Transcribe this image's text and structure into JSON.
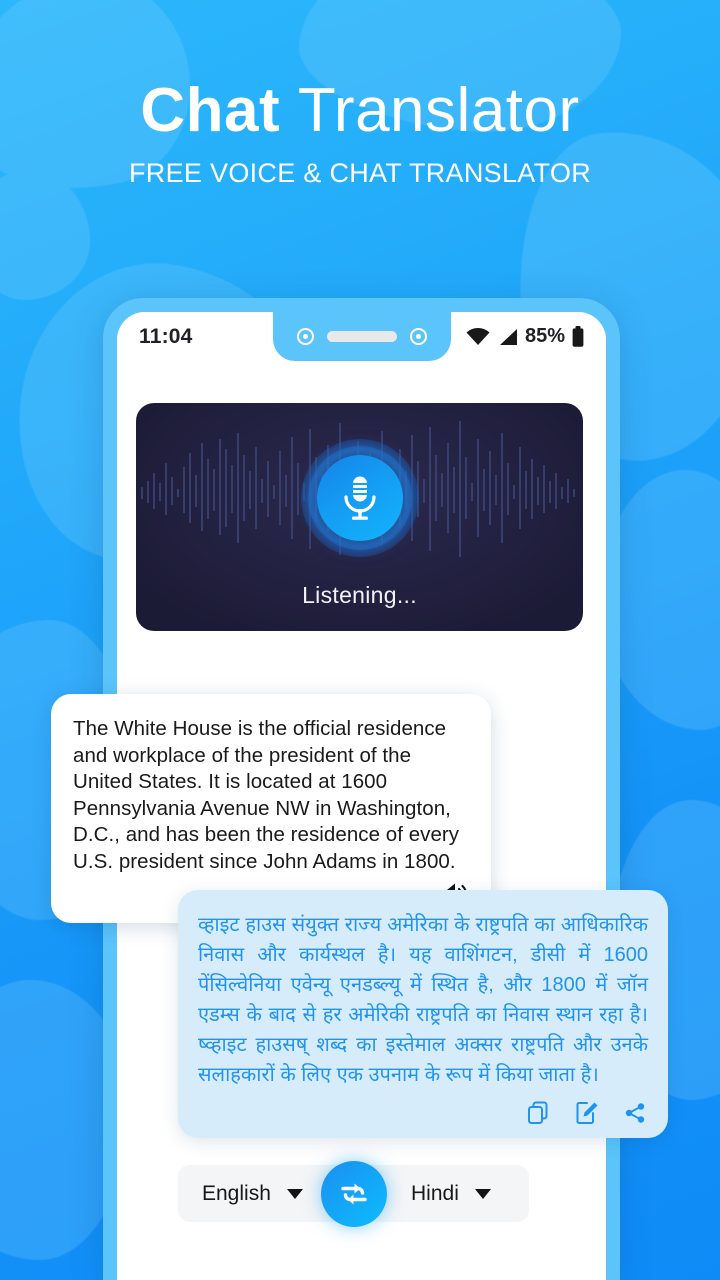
{
  "header": {
    "title_bold": "Chat",
    "title_light": "Translator",
    "subtitle": "FREE VOICE & CHAT TRANSLATOR"
  },
  "status_bar": {
    "time": "11:04",
    "battery_percent": "85%",
    "wifi_icon": "wifi-icon",
    "signal_icon": "signal-icon",
    "battery_icon": "battery-icon"
  },
  "mic_panel": {
    "status_label": "Listening...",
    "mic_icon": "microphone-icon"
  },
  "messages": {
    "source": {
      "language": "English",
      "text": "The White House is the official residence and workplace of the president of the United States. It is located at 1600 Pennsylvania Avenue NW in Washington, D.C., and has been the residence of every U.S. president since John Adams in 1800.",
      "speak_icon": "speaker-icon"
    },
    "translated": {
      "language": "Hindi",
      "text": "व्हाइट हाउस संयुक्त राज्य अमेरिका के राष्ट्रपति का आधिकारिक निवास और कार्यस्थल है। यह वाशिंगटन, डीसी में 1600 पेंसिल्वेनिया एवेन्यू एनडब्ल्यू में स्थित है, और 1800 में जॉन एडम्स के बाद से हर अमेरिकी राष्ट्रपति का निवास स्थान रहा है। ष्व्हाइट हाउसष् शब्द का इस्तेमाल अक्सर राष्ट्रपति और उनके सलाहकारों के लिए एक उपनाम के रूप में किया जाता है।",
      "copy_icon": "copy-icon",
      "edit_icon": "edit-icon",
      "share_icon": "share-icon"
    }
  },
  "language_bar": {
    "source_language": "English",
    "target_language": "Hindi",
    "source_caret_icon": "chevron-down-icon",
    "target_caret_icon": "chevron-down-icon",
    "swap_icon": "swap-arrows-icon"
  },
  "colors": {
    "background_top": "#2BB7FB",
    "background_bottom": "#0F8BF7",
    "accent_blue": "#12A2F6",
    "phone_bezel": "#5BC4FB",
    "mic_panel_dark": "#21203C",
    "bubble_translated_bg": "#D6ECFB",
    "bubble_translated_text": "#1F93EE"
  }
}
